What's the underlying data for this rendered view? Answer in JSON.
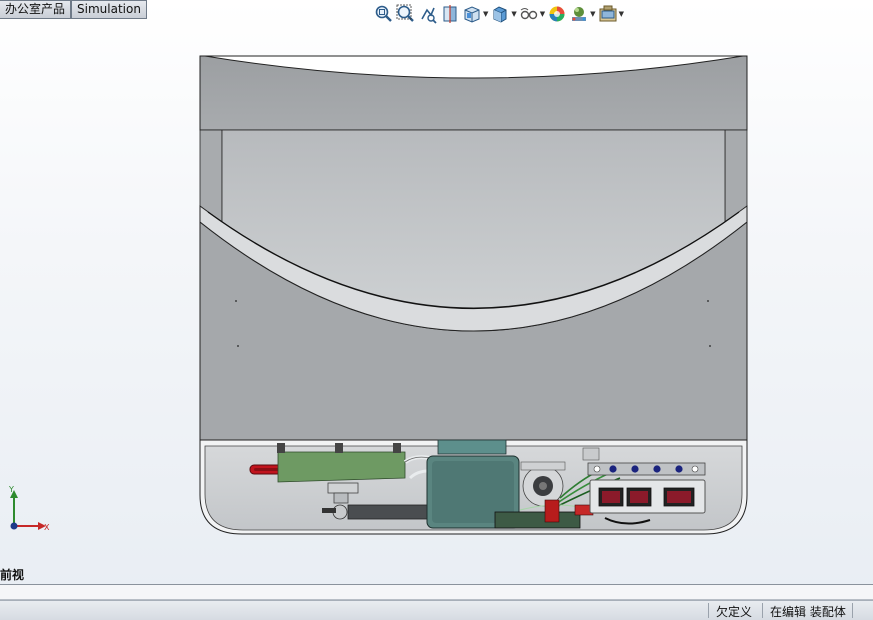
{
  "tabs": [
    "办公室产品",
    "Simulation"
  ],
  "toolbar": {
    "icons": [
      {
        "name": "zoom-to-fit-icon",
        "dropdown": false
      },
      {
        "name": "zoom-to-area-icon",
        "dropdown": false
      },
      {
        "name": "previous-view-icon",
        "dropdown": false
      },
      {
        "name": "section-view-icon",
        "dropdown": false
      },
      {
        "name": "view-orientation-icon",
        "dropdown": true
      },
      {
        "name": "display-style-icon",
        "dropdown": true
      },
      {
        "name": "hide-show-items-icon",
        "dropdown": true
      },
      {
        "name": "edit-appearance-icon",
        "dropdown": false
      },
      {
        "name": "apply-scene-icon",
        "dropdown": true
      },
      {
        "name": "view-settings-icon",
        "dropdown": true
      }
    ]
  },
  "triad": {
    "x_label": "X",
    "y_label": "Y"
  },
  "view_label": "前视",
  "status": {
    "definition": "欠定义",
    "editing": "在编辑 装配体"
  },
  "colors": {
    "body": "#a3a6a9",
    "panel": "#c6c9cc",
    "control_panel": "#e4e6e8",
    "indicator": "#8b1a2a",
    "heater": "#c1141d"
  }
}
